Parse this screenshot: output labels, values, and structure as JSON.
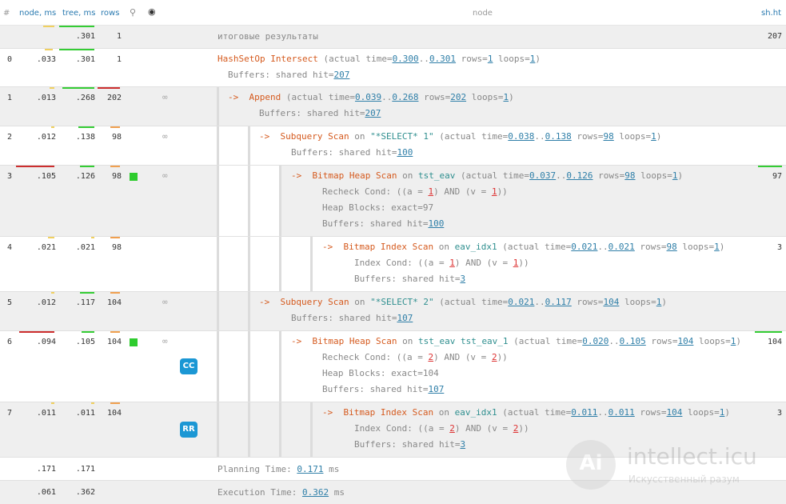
{
  "header": {
    "hash": "#",
    "node_ms": "node, ms",
    "tree_ms": "tree, ms",
    "rows": "rows",
    "search_icon": "magnifier-icon",
    "eye_icon": "eye-icon",
    "node": "node",
    "sh_ht": "sh.ht"
  },
  "summary": {
    "tree": ".301",
    "rows": "1",
    "label": "итоговые результаты",
    "sh": "207"
  },
  "rows": [
    {
      "num": "0",
      "node": ".033",
      "tree": ".301",
      "rows": "1",
      "sh": ""
    },
    {
      "num": "1",
      "node": ".013",
      "tree": ".268",
      "rows": "202",
      "sh": ""
    },
    {
      "num": "2",
      "node": ".012",
      "tree": ".138",
      "rows": "98",
      "sh": ""
    },
    {
      "num": "3",
      "node": ".105",
      "tree": ".126",
      "rows": "98",
      "sh": "97"
    },
    {
      "num": "4",
      "node": ".021",
      "tree": ".021",
      "rows": "98",
      "sh": "3"
    },
    {
      "num": "5",
      "node": ".012",
      "tree": ".117",
      "rows": "104",
      "sh": ""
    },
    {
      "num": "6",
      "node": ".094",
      "tree": ".105",
      "rows": "104",
      "sh": "104"
    },
    {
      "num": "7",
      "node": ".011",
      "tree": ".011",
      "rows": "104",
      "sh": "3"
    }
  ],
  "badges": {
    "cc": "CC",
    "rr": "RR"
  },
  "plan": {
    "r0": {
      "op": "HashSetOp Intersect",
      "a": " (actual time=",
      "t1": "0.300",
      "dots": "..",
      "t2": "0.301",
      "b": " rows=",
      "rows": "1",
      "c": " loops=",
      "loops": "1",
      "d": ")",
      "buf": "Buffers: shared hit=",
      "hit": "207"
    },
    "r1": {
      "arrow": "->  ",
      "op": "Append",
      "a": " (actual time=",
      "t1": "0.039",
      "dots": "..",
      "t2": "0.268",
      "b": " rows=",
      "rows": "202",
      "c": " loops=",
      "loops": "1",
      "d": ")",
      "buf": "Buffers: shared hit=",
      "hit": "207"
    },
    "r2": {
      "arrow": "->  ",
      "op": "Subquery Scan",
      "on": " on ",
      "rel": "\"*SELECT* 1\"",
      "a": " (actual time=",
      "t1": "0.038",
      "dots": "..",
      "t2": "0.138",
      "b": " rows=",
      "rows": "98",
      "c": " loops=",
      "loops": "1",
      "d": ")",
      "buf": "Buffers: shared hit=",
      "hit": "100"
    },
    "r3": {
      "arrow": "->  ",
      "op": "Bitmap Heap Scan",
      "on": " on ",
      "rel": "tst_eav",
      "a": " (actual time=",
      "t1": "0.037",
      "dots": "..",
      "t2": "0.126",
      "b": " rows=",
      "rows": "98",
      "c": " loops=",
      "loops": "1",
      "d": ")",
      "cond_a": "Recheck Cond: ((a = ",
      "v1": "1",
      "cond_b": ") AND (v = ",
      "v2": "1",
      "cond_c": "))",
      "heap": "Heap Blocks: exact=97",
      "buf": "Buffers: shared hit=",
      "hit": "100"
    },
    "r4": {
      "arrow": "->  ",
      "op": "Bitmap Index Scan",
      "on": " on ",
      "rel": "eav_idx1",
      "a": " (actual time=",
      "t1": "0.021",
      "dots": "..",
      "t2": "0.021",
      "b": " rows=",
      "rows": "98",
      "c": " loops=",
      "loops": "1",
      "d": ")",
      "cond_a": "Index Cond: ((a = ",
      "v1": "1",
      "cond_b": ") AND (v = ",
      "v2": "1",
      "cond_c": "))",
      "buf": "Buffers: shared hit=",
      "hit": "3"
    },
    "r5": {
      "arrow": "->  ",
      "op": "Subquery Scan",
      "on": " on ",
      "rel": "\"*SELECT* 2\"",
      "a": " (actual time=",
      "t1": "0.021",
      "dots": "..",
      "t2": "0.117",
      "b": " rows=",
      "rows": "104",
      "c": " loops=",
      "loops": "1",
      "d": ")",
      "buf": "Buffers: shared hit=",
      "hit": "107"
    },
    "r6": {
      "arrow": "->  ",
      "op": "Bitmap Heap Scan",
      "on": " on ",
      "rel": "tst_eav tst_eav_1",
      "a": " (actual time=",
      "t1": "0.020",
      "dots": "..",
      "t2": "0.105",
      "b": " rows=",
      "rows": "104",
      "c": " loops=",
      "loops": "1",
      "d": ")",
      "cond_a": "Recheck Cond: ((a = ",
      "v1": "2",
      "cond_b": ") AND (v = ",
      "v2": "2",
      "cond_c": "))",
      "heap": "Heap Blocks: exact=104",
      "buf": "Buffers: shared hit=",
      "hit": "107"
    },
    "r7": {
      "arrow": "->  ",
      "op": "Bitmap Index Scan",
      "on": " on ",
      "rel": "eav_idx1",
      "a": " (actual time=",
      "t1": "0.011",
      "dots": "..",
      "t2": "0.011",
      "b": " rows=",
      "rows": "104",
      "c": " loops=",
      "loops": "1",
      "d": ")",
      "cond_a": "Index Cond: ((a = ",
      "v1": "2",
      "cond_b": ") AND (v = ",
      "v2": "2",
      "cond_c": "))",
      "buf": "Buffers: shared hit=",
      "hit": "3"
    }
  },
  "planning": {
    "node": ".171",
    "tree": ".171",
    "label": "Planning Time: ",
    "value": "0.171",
    "unit": " ms"
  },
  "execution": {
    "node": ".061",
    "tree": ".362",
    "label": "Execution Time: ",
    "value": "0.362",
    "unit": " ms"
  },
  "watermark": {
    "logo": "Ai",
    "title": "intellect.icu",
    "subtitle": "Искусственный разум"
  },
  "colors": {
    "green": "#34cc34",
    "red": "#cc2e2e",
    "orange": "#f0a050",
    "yellow": "#f0d060",
    "badge": "#1b97d4"
  }
}
